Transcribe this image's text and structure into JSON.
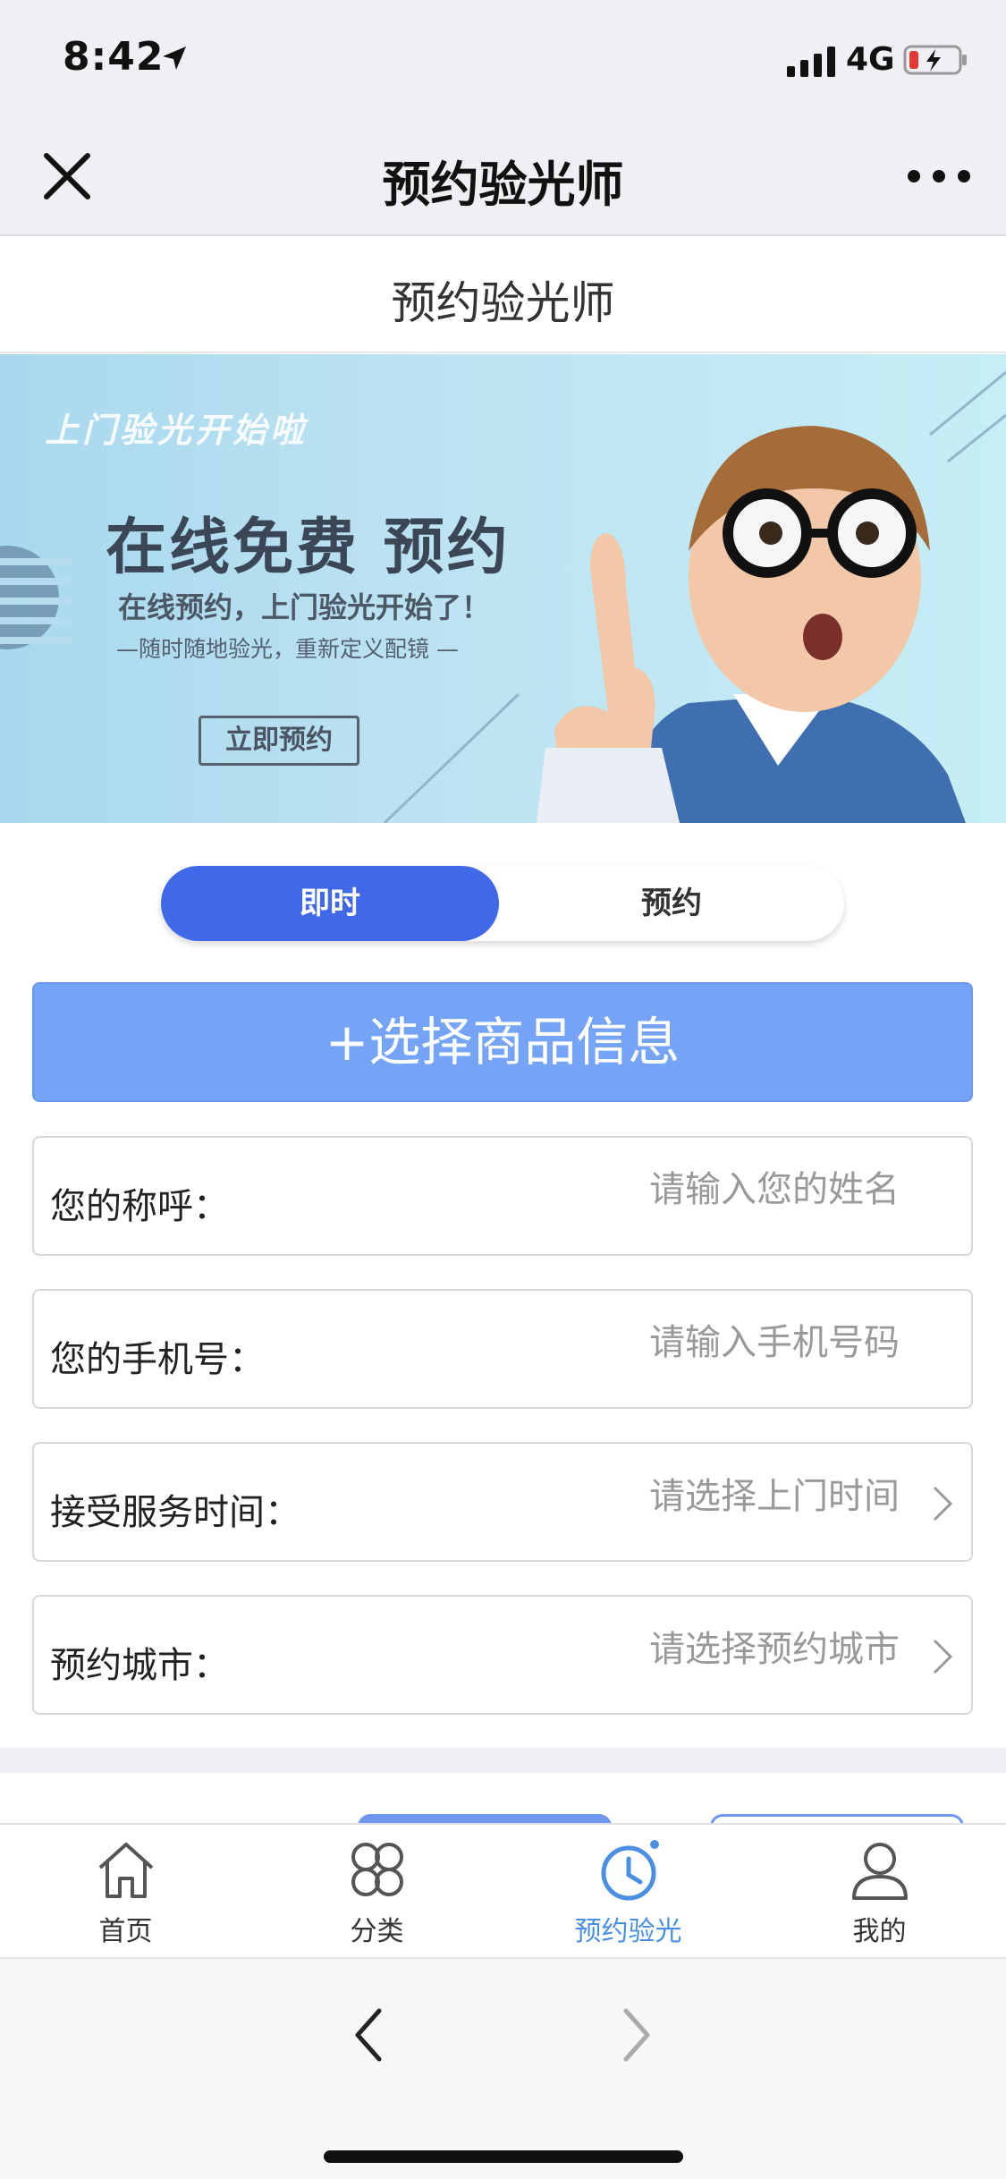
{
  "status_bar": {
    "time": "8:42",
    "network": "4G",
    "icons": [
      "location-arrow-icon",
      "signal-icon",
      "battery-charging-icon"
    ]
  },
  "nav": {
    "title": "预约验光师",
    "icons": [
      "close-icon",
      "more-icon"
    ]
  },
  "page": {
    "title": "预约验光师"
  },
  "banner": {
    "tag": "上门验光开始啦",
    "headline": "在线免费 预约",
    "sub": "在线预约，上门验光开始了！",
    "slogan": "—随时随地验光，重新定义配镜 —",
    "cta": "立即预约"
  },
  "segment": {
    "active_label": "即时",
    "inactive_label": "预约"
  },
  "select_product_label": "+选择商品信息",
  "form": {
    "name": {
      "label": "您的称呼：",
      "placeholder": "请输入您的姓名"
    },
    "phone": {
      "label": "您的手机号：",
      "placeholder": "请输入手机号码"
    },
    "time": {
      "label": "接受服务时间：",
      "value": "请选择上门时间"
    },
    "city": {
      "label": "预约城市：",
      "value": "请选择预约城市"
    }
  },
  "tab_bar": {
    "items": [
      {
        "label": "首页",
        "icon": "home-icon"
      },
      {
        "label": "分类",
        "icon": "category-icon"
      },
      {
        "label": "预约验光",
        "icon": "clock-icon"
      },
      {
        "label": "我的",
        "icon": "user-icon"
      }
    ],
    "active_index": 2,
    "active_color": "#4a8fe4"
  },
  "colors": {
    "accent": "#4068e8",
    "button": "#75a3f5"
  }
}
